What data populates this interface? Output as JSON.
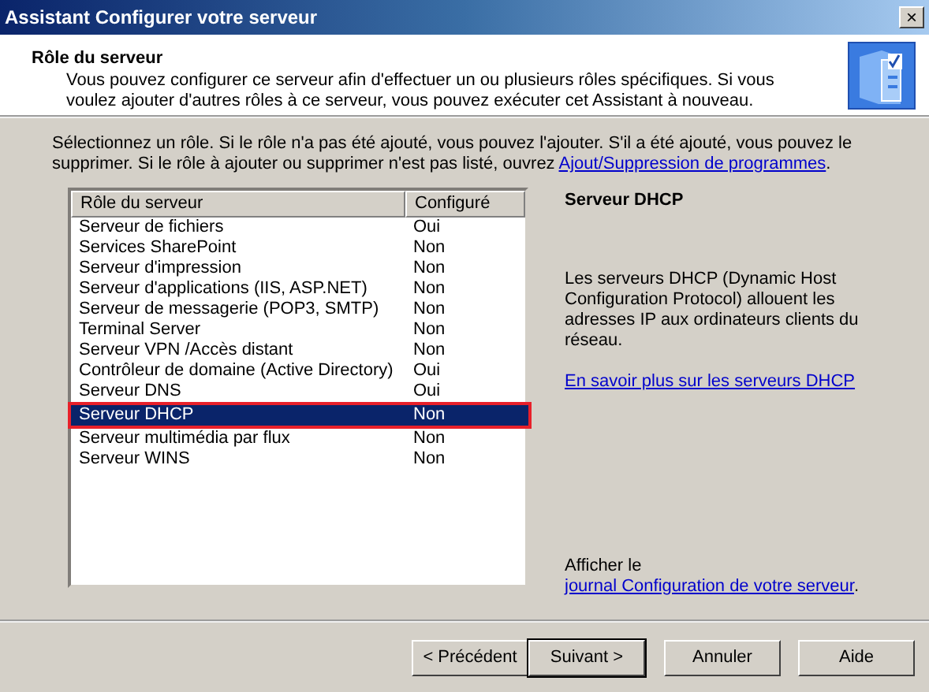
{
  "window": {
    "title": "Assistant Configurer votre serveur",
    "close": "×"
  },
  "header": {
    "title": "Rôle du serveur",
    "description": "Vous pouvez configurer ce serveur afin d'effectuer un ou plusieurs rôles spécifiques. Si vous voulez ajouter d'autres rôles à ce serveur, vous pouvez exécuter cet Assistant à nouveau."
  },
  "intro": {
    "text": "Sélectionnez un rôle. Si le rôle n'a pas été ajouté, vous pouvez l'ajouter. S'il a été ajouté, vous pouvez le supprimer. Si le rôle à ajouter ou supprimer n'est pas listé, ouvrez ",
    "link": "Ajout/Suppression de programmes",
    "after": "."
  },
  "table": {
    "columns": [
      "Rôle du serveur",
      "Configuré"
    ],
    "rows": [
      {
        "role": "Serveur de fichiers",
        "configured": "Oui",
        "selected": false
      },
      {
        "role": "Services SharePoint",
        "configured": "Non",
        "selected": false
      },
      {
        "role": "Serveur d'impression",
        "configured": "Non",
        "selected": false
      },
      {
        "role": "Serveur d'applications (IIS, ASP.NET)",
        "configured": "Non",
        "selected": false
      },
      {
        "role": "Serveur de messagerie (POP3, SMTP)",
        "configured": "Non",
        "selected": false
      },
      {
        "role": "Terminal Server",
        "configured": "Non",
        "selected": false
      },
      {
        "role": "Serveur VPN /Accès distant",
        "configured": "Non",
        "selected": false
      },
      {
        "role": "Contrôleur de domaine (Active Directory)",
        "configured": "Oui",
        "selected": false
      },
      {
        "role": "Serveur DNS",
        "configured": "Oui",
        "selected": false
      },
      {
        "role": "Serveur DHCP",
        "configured": "Non",
        "selected": true
      },
      {
        "role": "Serveur multimédia par flux",
        "configured": "Non",
        "selected": false
      },
      {
        "role": "Serveur WINS",
        "configured": "Non",
        "selected": false
      }
    ]
  },
  "details": {
    "title": "Serveur DHCP",
    "description": "Les serveurs DHCP (Dynamic Host Configuration Protocol) allouent les adresses IP aux ordinateurs clients du réseau.",
    "link": "En savoir plus sur les serveurs DHCP",
    "log_text": "Afficher le ",
    "log_link": "journal Configuration de votre serveur",
    "log_after": "."
  },
  "buttons": [
    {
      "label": "< Précédent",
      "default": false
    },
    {
      "label": "Suivant >",
      "default": true
    },
    {
      "label": "Annuler",
      "default": false
    },
    {
      "label": "Aide",
      "default": false
    }
  ]
}
